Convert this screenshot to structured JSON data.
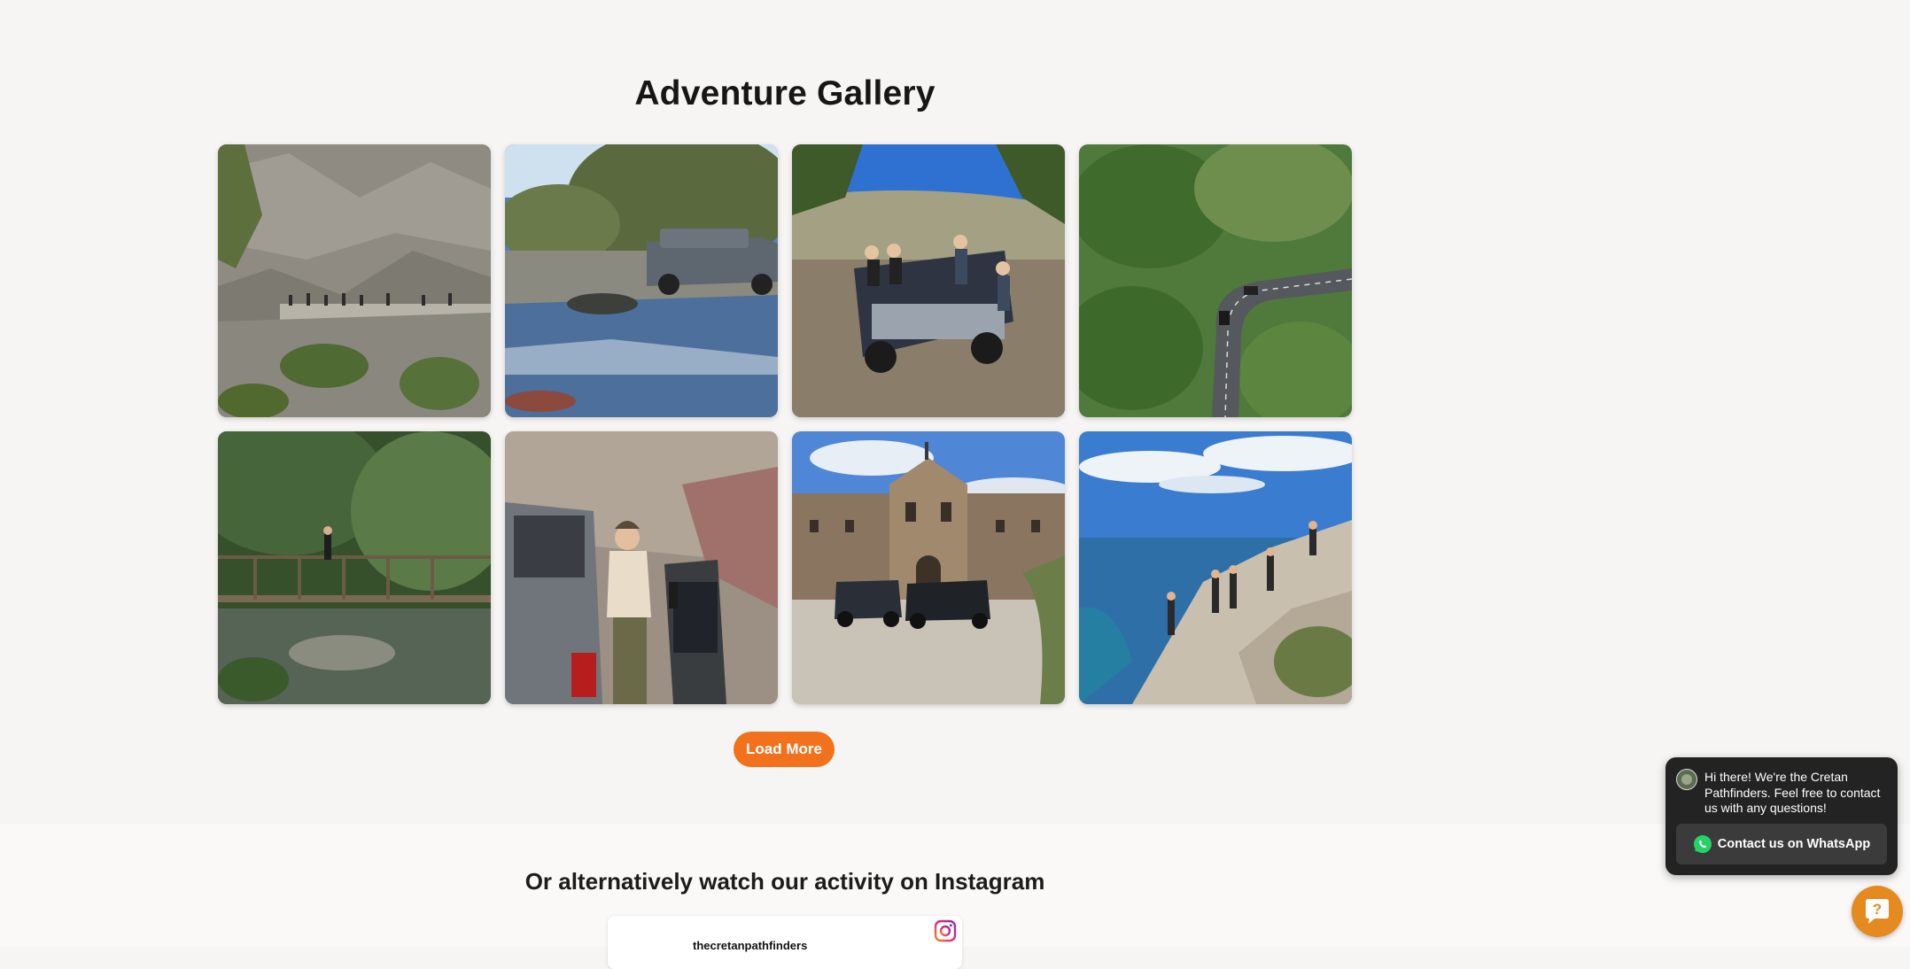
{
  "gallery": {
    "title": "Adventure Gallery",
    "load_more_label": "Load More",
    "photos": [
      {
        "subject": "mountain-gorge-hikers-photo"
      },
      {
        "subject": "river-crossing-suv-photo"
      },
      {
        "subject": "group-with-suv-photo"
      },
      {
        "subject": "winding-road-aerial-photo"
      },
      {
        "subject": "forest-wooden-bridge-photo"
      },
      {
        "subject": "woman-by-suv-door-photo"
      },
      {
        "subject": "monastery-with-suvs-photo"
      },
      {
        "subject": "coastal-cliff-group-photo"
      }
    ]
  },
  "instagram": {
    "heading": "Or alternatively watch our activity on Instagram",
    "handle": "thecretanpathfinders"
  },
  "chat": {
    "message": "Hi there! We're the Cretan Pathfinders. Feel free to contact us with any questions!",
    "whatsapp_label": "Contact us on WhatsApp",
    "accent_color": "#f2711c"
  }
}
